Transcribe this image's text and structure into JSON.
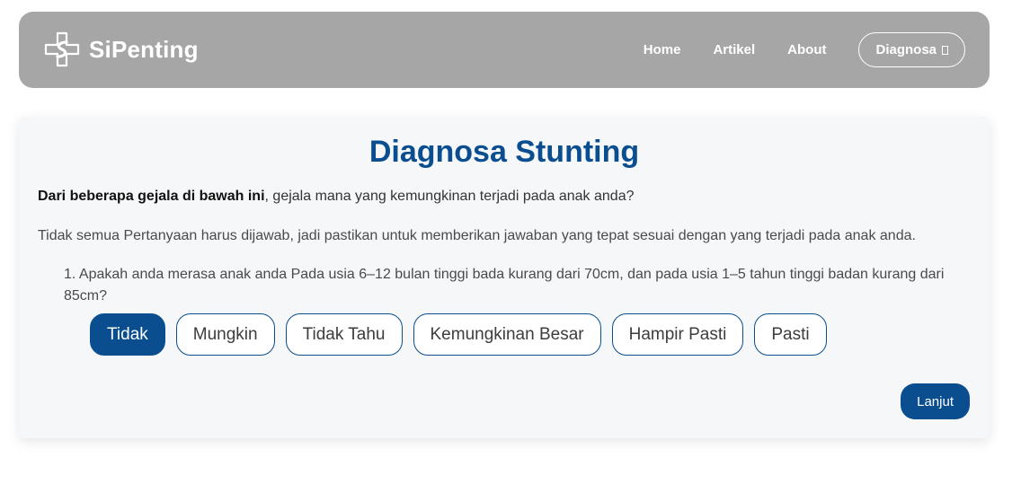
{
  "navbar": {
    "brand_name": "SiPenting",
    "links": [
      "Home",
      "Artikel",
      "About"
    ],
    "cta_label": "Diagnosa",
    "cta_icon": "external-box-icon",
    "logo_icon": "medical-cross-icon"
  },
  "card": {
    "title": "Diagnosa Stunting",
    "intro_bold": "Dari beberapa gejala di bawah ini",
    "intro_rest": ", gejala mana yang kemungkinan terjadi pada anak anda?",
    "note": "Tidak semua Pertanyaan harus dijawab, jadi pastikan untuk memberikan jawaban yang tepat sesuai dengan yang terjadi pada anak anda.",
    "question": "1. Apakah anda merasa anak anda Pada usia 6–12 bulan tinggi bada kurang dari 70cm, dan pada usia 1–5 tahun tinggi badan kurang dari 85cm?",
    "answers": [
      "Tidak",
      "Mungkin",
      "Tidak Tahu",
      "Kemungkinan Besar",
      "Hampir Pasti",
      "Pasti"
    ],
    "selected_answer": "Tidak",
    "next_label": "Lanjut"
  },
  "colors": {
    "navbar_bg": "#a6a6a6",
    "primary": "#0b4e8f",
    "card_bg": "#f6f7f9"
  }
}
